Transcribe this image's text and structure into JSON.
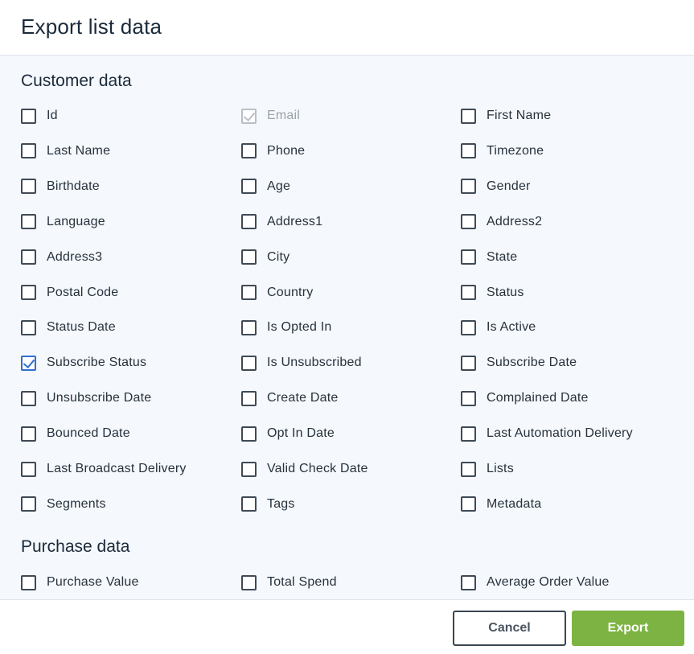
{
  "dialog": {
    "title": "Export list data"
  },
  "sections": [
    {
      "title": "Customer data",
      "options": [
        {
          "label": "Id",
          "checked": false,
          "disabled": false
        },
        {
          "label": "Email",
          "checked": true,
          "disabled": true
        },
        {
          "label": "First Name",
          "checked": false,
          "disabled": false
        },
        {
          "label": "Last Name",
          "checked": false,
          "disabled": false
        },
        {
          "label": "Phone",
          "checked": false,
          "disabled": false
        },
        {
          "label": "Timezone",
          "checked": false,
          "disabled": false
        },
        {
          "label": "Birthdate",
          "checked": false,
          "disabled": false
        },
        {
          "label": "Age",
          "checked": false,
          "disabled": false
        },
        {
          "label": "Gender",
          "checked": false,
          "disabled": false
        },
        {
          "label": "Language",
          "checked": false,
          "disabled": false
        },
        {
          "label": "Address1",
          "checked": false,
          "disabled": false
        },
        {
          "label": "Address2",
          "checked": false,
          "disabled": false
        },
        {
          "label": "Address3",
          "checked": false,
          "disabled": false
        },
        {
          "label": "City",
          "checked": false,
          "disabled": false
        },
        {
          "label": "State",
          "checked": false,
          "disabled": false
        },
        {
          "label": "Postal Code",
          "checked": false,
          "disabled": false
        },
        {
          "label": "Country",
          "checked": false,
          "disabled": false
        },
        {
          "label": "Status",
          "checked": false,
          "disabled": false
        },
        {
          "label": "Status Date",
          "checked": false,
          "disabled": false
        },
        {
          "label": "Is Opted In",
          "checked": false,
          "disabled": false
        },
        {
          "label": "Is Active",
          "checked": false,
          "disabled": false
        },
        {
          "label": "Subscribe Status",
          "checked": true,
          "disabled": false
        },
        {
          "label": "Is Unsubscribed",
          "checked": false,
          "disabled": false
        },
        {
          "label": "Subscribe Date",
          "checked": false,
          "disabled": false
        },
        {
          "label": "Unsubscribe Date",
          "checked": false,
          "disabled": false
        },
        {
          "label": "Create Date",
          "checked": false,
          "disabled": false
        },
        {
          "label": "Complained Date",
          "checked": false,
          "disabled": false
        },
        {
          "label": "Bounced Date",
          "checked": false,
          "disabled": false
        },
        {
          "label": "Opt In Date",
          "checked": false,
          "disabled": false
        },
        {
          "label": "Last Automation Delivery",
          "checked": false,
          "disabled": false
        },
        {
          "label": "Last Broadcast Delivery",
          "checked": false,
          "disabled": false
        },
        {
          "label": "Valid Check Date",
          "checked": false,
          "disabled": false
        },
        {
          "label": "Lists",
          "checked": false,
          "disabled": false
        },
        {
          "label": "Segments",
          "checked": false,
          "disabled": false
        },
        {
          "label": "Tags",
          "checked": false,
          "disabled": false
        },
        {
          "label": "Metadata",
          "checked": false,
          "disabled": false
        }
      ]
    },
    {
      "title": "Purchase data",
      "options": [
        {
          "label": "Purchase Value",
          "checked": false,
          "disabled": false
        },
        {
          "label": "Total Spend",
          "checked": false,
          "disabled": false
        },
        {
          "label": "Average Order Value",
          "checked": false,
          "disabled": false
        }
      ]
    }
  ],
  "footer": {
    "cancel_label": "Cancel",
    "export_label": "Export"
  },
  "colors": {
    "export_button": "#7cb342",
    "checkbox_checked": "#2f6fd0",
    "body_background": "#f5f8fc"
  }
}
